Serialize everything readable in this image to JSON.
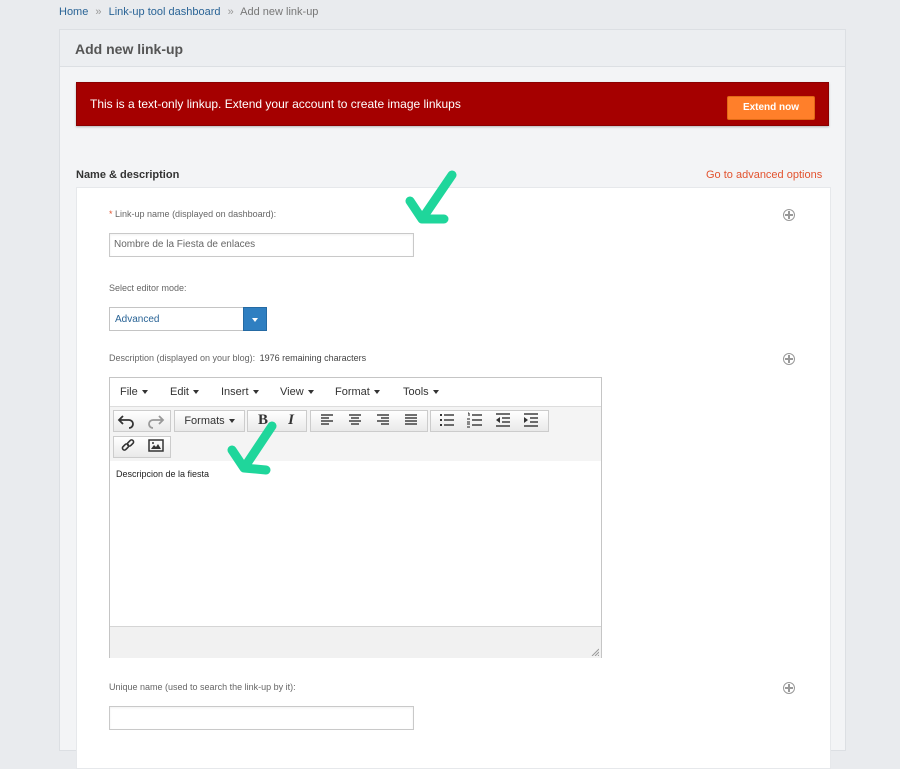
{
  "breadcrumb": {
    "home": "Home",
    "separator": "»",
    "dashboard": "Link-up tool dashboard",
    "current": "Add new link-up"
  },
  "panel": {
    "title": "Add new link-up"
  },
  "alert": {
    "message": "This is a text-only linkup. Extend your account to create image linkups",
    "button_label": "Extend now",
    "color": "#a50000",
    "button_color": "#ff7f2a"
  },
  "section": {
    "title": "Name & description",
    "advanced_link": "Go to advanced options"
  },
  "fields": {
    "linkup_name": {
      "required_mark": "*",
      "label": "Link-up name (displayed on dashboard):",
      "value": "Nombre de la Fiesta de enlaces"
    },
    "editor_mode": {
      "label": "Select editor mode:",
      "selected": "Advanced"
    },
    "description": {
      "label": "Description (displayed on your blog):",
      "remaining": "1976 remaining characters",
      "content": "Descripcion de la fiesta"
    },
    "unique_name": {
      "label": "Unique name (used to search the link-up by it):",
      "value": ""
    }
  },
  "editor": {
    "menu": [
      "File",
      "Edit",
      "Insert",
      "View",
      "Format",
      "Tools"
    ],
    "formats_label": "Formats",
    "bold_label": "B",
    "italic_label": "I",
    "icons": [
      "undo-icon",
      "redo-icon",
      "bold-icon",
      "italic-icon",
      "align-left-icon",
      "align-center-icon",
      "align-right-icon",
      "justify-icon",
      "bullet-list-icon",
      "numbered-list-icon",
      "outdent-icon",
      "indent-icon",
      "link-icon",
      "image-icon"
    ]
  },
  "annotation_color": "#1fd69b"
}
